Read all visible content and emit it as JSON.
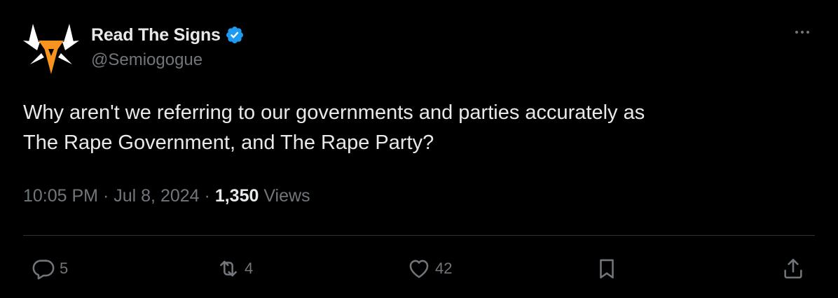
{
  "author": {
    "display_name": "Read The Signs",
    "handle": "@Semiogogue",
    "verified": true
  },
  "tweet": {
    "text_line1": "Why aren't we referring to our governments and parties accurately as",
    "text_line2": "The Rape Government, and The Rape Party?",
    "time": "10:05 PM",
    "separator": "·",
    "date": "Jul 8, 2024",
    "views_count": "1,350",
    "views_label": "Views"
  },
  "actions": {
    "reply_count": "5",
    "retweet_count": "4",
    "like_count": "42"
  },
  "icons": {
    "more": "more-dots-icon",
    "reply": "reply-icon",
    "retweet": "retweet-icon",
    "like": "heart-icon",
    "bookmark": "bookmark-icon",
    "share": "share-icon",
    "verified": "verified-badge-icon"
  },
  "colors": {
    "background": "#000000",
    "text": "#e7e9ea",
    "muted": "#71767b",
    "verified_blue": "#1d9bf0",
    "avatar_orange": "#f7931e"
  }
}
